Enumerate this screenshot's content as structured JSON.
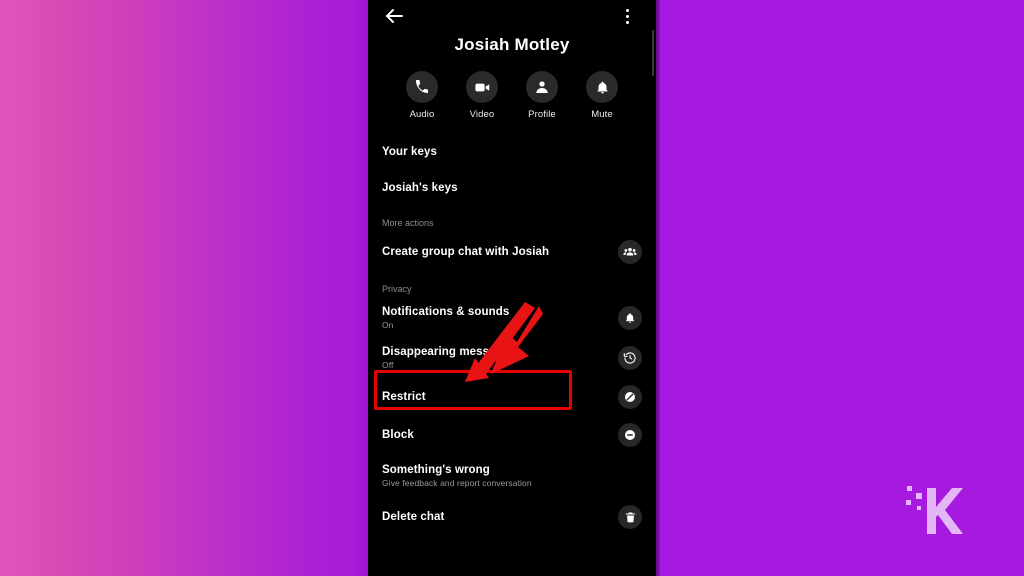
{
  "background": {
    "left_gradient_from": "#e055bb",
    "left_gradient_to": "#a61ad8",
    "right_color": "#a61ae0"
  },
  "phone": {
    "background": "#000000",
    "topbar": {
      "back_icon": "arrow-left-icon",
      "overflow_icon": "kebab-menu-icon"
    },
    "contact_name": "Josiah Motley",
    "quick_actions": [
      {
        "label": "Audio",
        "icon": "phone-icon"
      },
      {
        "label": "Video",
        "icon": "video-camera-icon"
      },
      {
        "label": "Profile",
        "icon": "person-icon"
      },
      {
        "label": "Mute",
        "icon": "bell-icon"
      }
    ],
    "sections": [
      {
        "label": null,
        "items": [
          {
            "title": "Your keys",
            "subtitle": null,
            "icon": null
          },
          {
            "title": "Josiah's keys",
            "subtitle": null,
            "icon": null
          }
        ]
      },
      {
        "label": "More actions",
        "items": [
          {
            "title": "Create group chat with Josiah",
            "subtitle": null,
            "icon": "people-group-icon"
          }
        ]
      },
      {
        "label": "Privacy",
        "items": [
          {
            "title": "Notifications & sounds",
            "subtitle": "On",
            "icon": "bell-icon"
          },
          {
            "title": "Disappearing messages",
            "subtitle": "Off",
            "icon": "clock-history-icon"
          },
          {
            "title": "Restrict",
            "subtitle": null,
            "icon": "slash-circle-icon"
          },
          {
            "title": "Block",
            "subtitle": null,
            "icon": "minus-circle-icon"
          },
          {
            "title": "Something's wrong",
            "subtitle": "Give feedback and report conversation",
            "icon": null
          },
          {
            "title": "Delete chat",
            "subtitle": null,
            "icon": "trash-icon"
          }
        ]
      }
    ]
  },
  "annotations": {
    "highlight_color": "#e60000",
    "highlight_target": "Disappearing messages",
    "arrow_color": "#e81414",
    "arrow_points_to": "Disappearing messages"
  },
  "watermark": {
    "letter": "K",
    "color": "#e3b6f5"
  }
}
